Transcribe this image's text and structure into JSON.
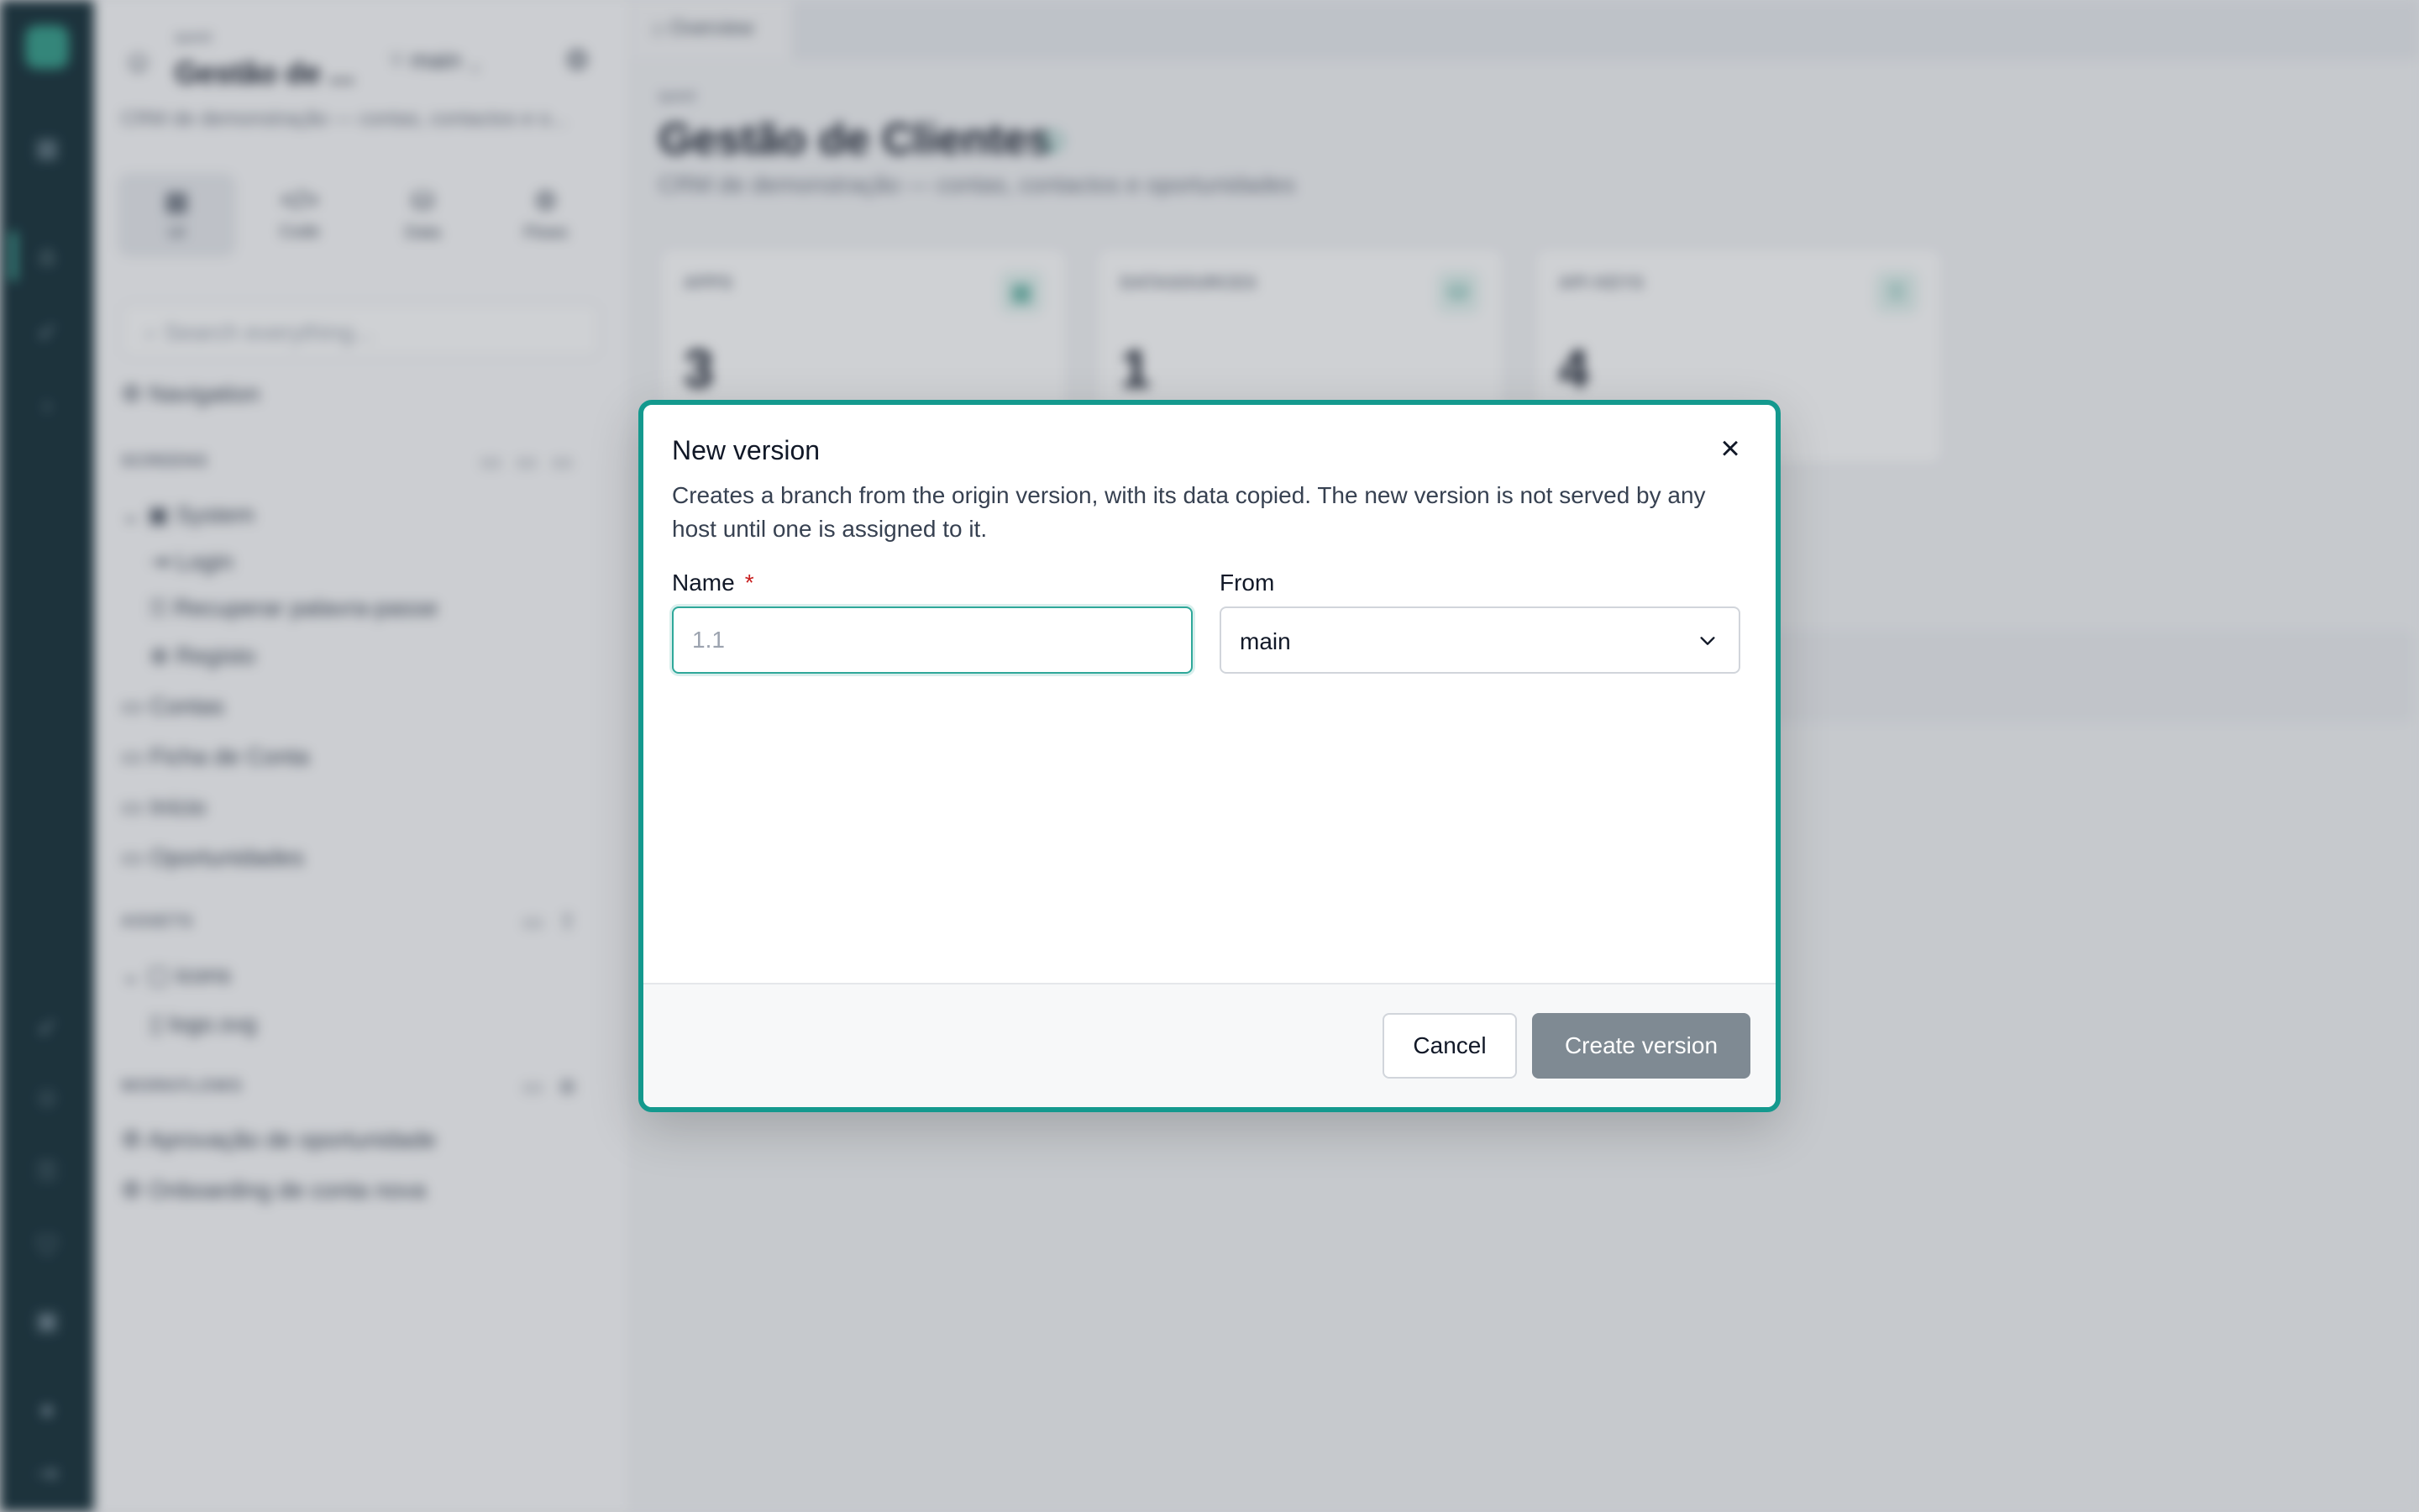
{
  "background": {
    "project": {
      "small_label": "quest",
      "title": "Gestão de ...",
      "branch": "main",
      "description": "CRM de demonstração — contas, contactos e o..."
    },
    "modes": [
      {
        "icon": "▦",
        "label": "UI"
      },
      {
        "icon": "</>",
        "label": "Code"
      },
      {
        "icon": "⛁",
        "label": "Data"
      },
      {
        "icon": "⚙",
        "label": "Flows"
      }
    ],
    "search_placeholder": "Search everything...",
    "nav": {
      "navigation": "Navigation",
      "screens_header": "SCREENS",
      "system": "System",
      "login": "Login",
      "recover": "Recuperar palavra-passe",
      "register": "Registo",
      "contas": "Contas",
      "ficha": "Ficha de Conta",
      "inicio": "Início",
      "oportunidades": "Oportunidades",
      "assets_header": "ASSETS",
      "icons": "icons",
      "logo": "logo.svg",
      "workflows_header": "WORKFLOWS",
      "wf1": "Aprovação de oportunidade",
      "wf2": "Onboarding de conta nova"
    },
    "main": {
      "tab": "Overview",
      "crumb": "quest",
      "title": "Gestão de Clientes",
      "subtitle": "CRM de demonstração — contas, contactos e oportunidades",
      "cards": [
        {
          "label": "APPS",
          "value": "3"
        },
        {
          "label": "DATASOURCES",
          "value": "1"
        },
        {
          "label": "API KEYS",
          "value": "4"
        }
      ]
    }
  },
  "dialog": {
    "title": "New version",
    "description": "Creates a branch from the origin version, with its data copied. The new version is not served by any host until one is assigned to it.",
    "name_label": "Name",
    "required_marker": "*",
    "name_placeholder": "1.1",
    "name_value": "",
    "from_label": "From",
    "from_value": "main",
    "cancel_label": "Cancel",
    "create_label": "Create version",
    "colors": {
      "accent": "#14998e",
      "required": "#c81e1e",
      "create_button_disabled": "#7f8a93"
    }
  }
}
